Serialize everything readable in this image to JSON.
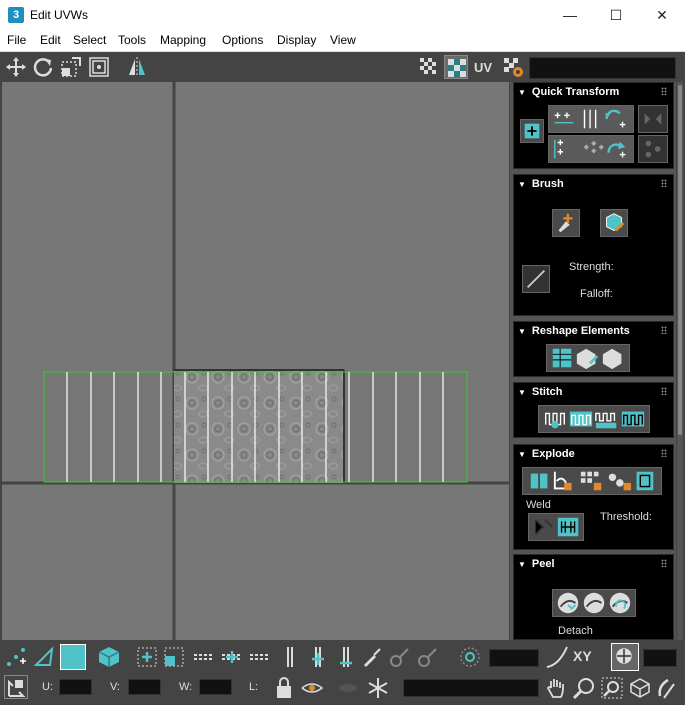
{
  "window": {
    "title": "Edit UVWs",
    "app_icon": "3"
  },
  "window_buttons": {
    "minimize": "—",
    "maximize": "☐",
    "close": "✕"
  },
  "menu": [
    "File",
    "Edit",
    "Select",
    "Tools",
    "Mapping",
    "Options",
    "Display",
    "View"
  ],
  "toolbar": {
    "uv_label": "UV",
    "texture_dropdown_value": ""
  },
  "panel": {
    "quick_transform": {
      "title": "Quick Transform"
    },
    "brush": {
      "title": "Brush",
      "strength_label": "Strength:",
      "falloff_label": "Falloff:"
    },
    "reshape": {
      "title": "Reshape Elements"
    },
    "stitch": {
      "title": "Stitch"
    },
    "explode": {
      "title": "Explode",
      "weld_label": "Weld",
      "threshold_label": "Threshold:"
    },
    "peel": {
      "title": "Peel",
      "detach_label": "Detach"
    }
  },
  "bottom": {
    "xy_label": "XY",
    "u_label": "U:",
    "v_label": "V:",
    "w_label": "W:",
    "l_label": "L:",
    "u_value": "",
    "v_value": "",
    "w_value": "",
    "l_value": ""
  },
  "colors": {
    "accent": "#4fc3c8",
    "selection": "#33cc33",
    "viewport": "#777777",
    "panel_bg": "#000000"
  }
}
